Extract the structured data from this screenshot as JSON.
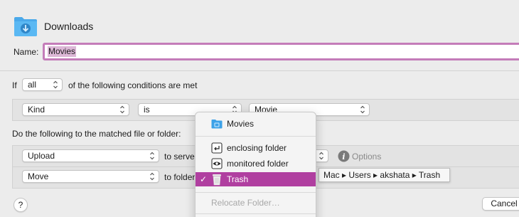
{
  "header": {
    "title": "Downloads",
    "folder_icon": "blue-downloads-folder-icon"
  },
  "name_field": {
    "label": "Name:",
    "value": "Movies"
  },
  "conditions": {
    "if_label": "If",
    "match_value": "all",
    "suffix": "of the following conditions are met",
    "rule": {
      "attribute": "Kind",
      "operator": "is",
      "value": "Movie"
    }
  },
  "actions": {
    "heading": "Do the following to the matched file or folder:",
    "rows": [
      {
        "action": "Upload",
        "preposition": "to server",
        "options_label": "Options"
      },
      {
        "action": "Move",
        "preposition": "to folder"
      }
    ]
  },
  "menu": {
    "items": [
      {
        "label": "Movies",
        "icon": "blue-folder-icon"
      },
      {
        "label": "enclosing folder",
        "icon": "enclosing-folder-icon"
      },
      {
        "label": "monitored folder",
        "icon": "eye-icon"
      },
      {
        "label": "Trash",
        "icon": "trash-icon",
        "checked": true,
        "highlighted": true
      },
      {
        "label": "Relocate Folder…",
        "disabled": true
      }
    ],
    "checkmark": "✓"
  },
  "tooltip": {
    "path": "Mac ▸ Users ▸ akshata ▸ Trash"
  },
  "footer": {
    "help": "?",
    "cancel": "Cancel"
  },
  "colors": {
    "accent": "#b03fa0",
    "folder_blue": "#3da2e8",
    "name_border": "#b55ca8"
  }
}
